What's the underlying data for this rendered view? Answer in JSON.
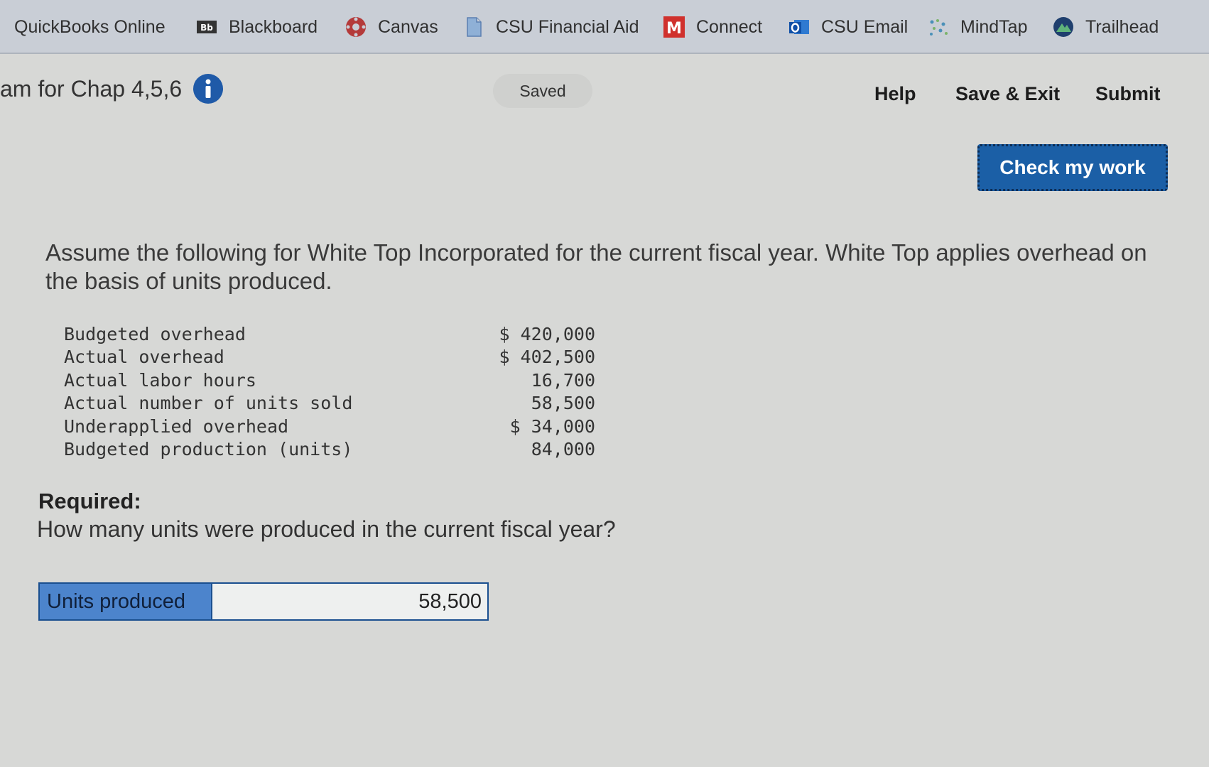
{
  "bookmarks": [
    {
      "label": "QuickBooks Online",
      "icon": "none"
    },
    {
      "label": "Blackboard",
      "icon": "blackboard-icon"
    },
    {
      "label": "Canvas",
      "icon": "canvas-icon"
    },
    {
      "label": "CSU Financial Aid",
      "icon": "document-icon"
    },
    {
      "label": "Connect",
      "icon": "mcgraw-hill-icon"
    },
    {
      "label": "CSU Email",
      "icon": "outlook-icon"
    },
    {
      "label": "MindTap",
      "icon": "mindtap-icon"
    },
    {
      "label": "Trailhead",
      "icon": "trailhead-icon"
    }
  ],
  "header": {
    "title": "am for Chap 4,5,6",
    "status": "Saved",
    "help": "Help",
    "save_exit": "Save & Exit",
    "submit": "Submit"
  },
  "check_button": "Check my work",
  "question": "Assume the following for White Top Incorporated for the current fiscal year. White Top applies overhead on the basis of units produced.",
  "data_rows": [
    {
      "label": "Budgeted overhead",
      "value": "$ 420,000"
    },
    {
      "label": "Actual overhead",
      "value": "$ 402,500"
    },
    {
      "label": "Actual labor hours",
      "value": "16,700"
    },
    {
      "label": "Actual number of units sold",
      "value": "58,500"
    },
    {
      "label": "Underapplied overhead",
      "value": "$ 34,000"
    },
    {
      "label": "Budgeted production (units)",
      "value": "84,000"
    }
  ],
  "required": {
    "heading": "Required:",
    "question": "How many units were produced in the current fiscal year?"
  },
  "answer": {
    "label": "Units produced",
    "value": "58,500"
  },
  "colors": {
    "accent": "#1b5fa6",
    "answer_label_bg": "#4c84cc"
  }
}
